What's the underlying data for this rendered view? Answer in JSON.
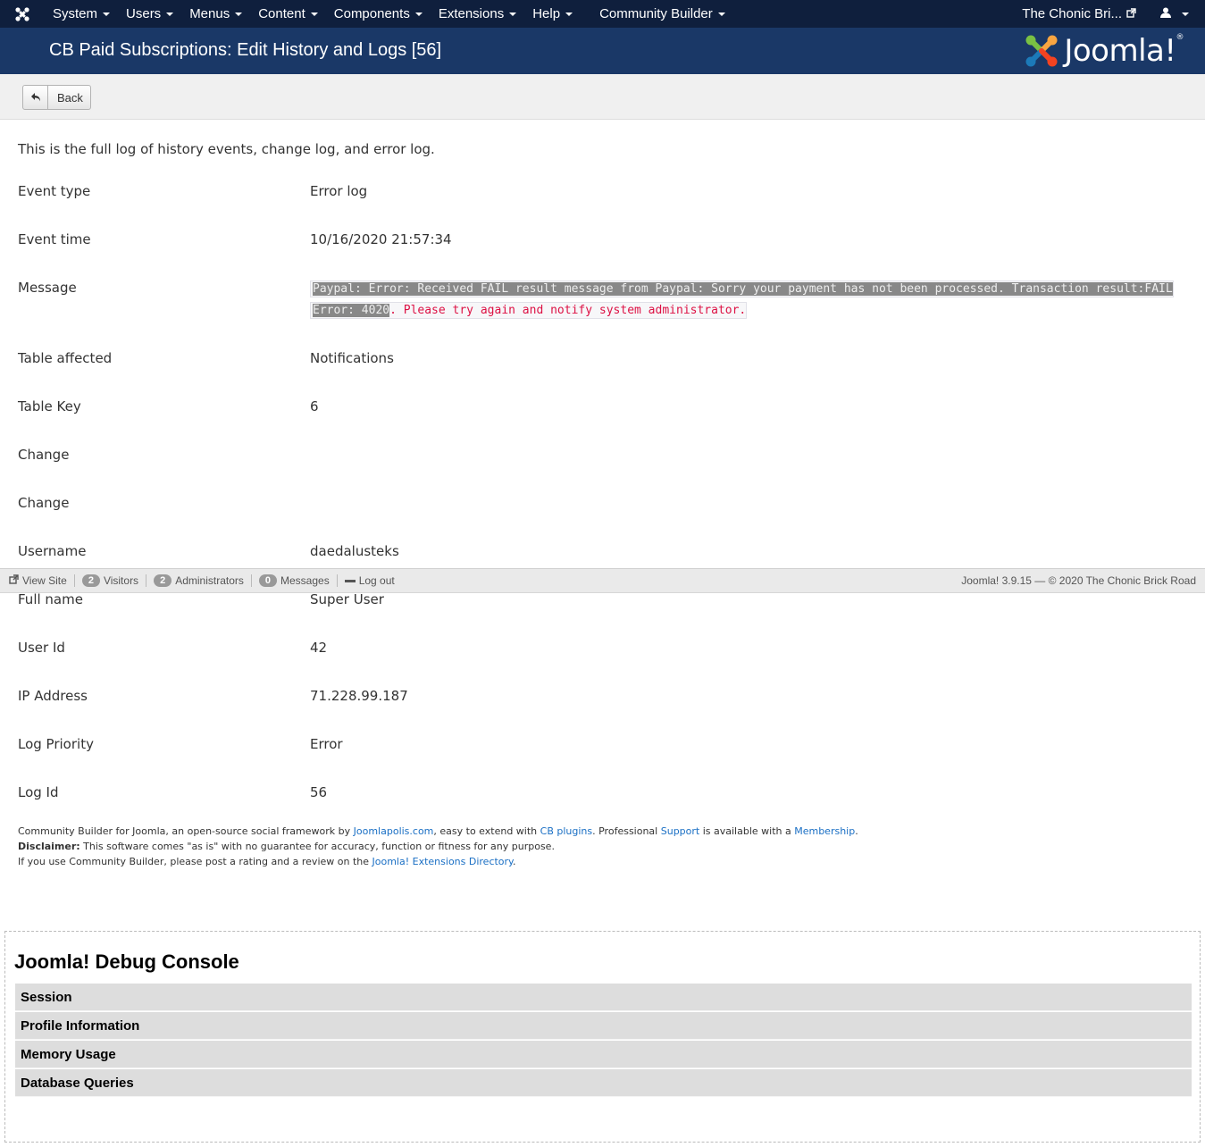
{
  "navbar": {
    "menus": [
      "System",
      "Users",
      "Menus",
      "Content",
      "Components",
      "Extensions",
      "Help",
      "Community Builder"
    ],
    "site_link": "The Chonic Bri...",
    "icons": {
      "logo": "joomla-icon",
      "user": "user-icon",
      "external": "external-link-icon"
    }
  },
  "header": {
    "title": "CB Paid Subscriptions: Edit History and Logs [56]",
    "brand": "Joomla!",
    "brand_mark": "®"
  },
  "toolbar": {
    "back_label": "Back"
  },
  "content": {
    "intro": "This is the full log of history events, change log, and error log.",
    "rows": {
      "event_type": {
        "label": "Event type",
        "value": "Error log"
      },
      "event_time": {
        "label": "Event time",
        "value": "10/16/2020 21:57:34"
      },
      "message": {
        "label": "Message",
        "value_highlighted_1": "Paypal: Error: Received FAIL result message from Paypal: Sorry your payment has not been processed. Transaction result:FAIL",
        "value_highlighted_2": "Error: 4020",
        "value_rest": ". Please try again and notify system administrator."
      },
      "table_affected": {
        "label": "Table affected",
        "value": "Notifications"
      },
      "table_key": {
        "label": "Table Key",
        "value": "6"
      },
      "change_1": {
        "label": "Change",
        "value": ""
      },
      "change_2": {
        "label": "Change",
        "value": ""
      },
      "username": {
        "label": "Username",
        "value": "daedalusteks"
      },
      "full_name": {
        "label": "Full name",
        "value": "Super User"
      },
      "user_id": {
        "label": "User Id",
        "value": "42"
      },
      "ip_address": {
        "label": "IP Address",
        "value": "71.228.99.187"
      },
      "log_priority": {
        "label": "Log Priority",
        "value": "Error"
      },
      "log_id": {
        "label": "Log Id",
        "value": "56"
      }
    }
  },
  "statusbar": {
    "view_site": "View Site",
    "visitors_count": "2",
    "visitors": "Visitors",
    "admins_count": "2",
    "admins": "Administrators",
    "messages_count": "0",
    "messages": "Messages",
    "logout": "Log out",
    "version": "Joomla! 3.9.15 — © 2020 The Chonic Brick Road"
  },
  "footer": {
    "line1_a": "Community Builder for Joomla, an open-source social framework by ",
    "link_joomlapolis": "Joomlapolis.com",
    "line1_b": ", easy to extend with ",
    "link_cb_plugins": "CB plugins",
    "line1_c": ". Professional ",
    "link_support": "Support",
    "line1_d": " is available with a ",
    "link_membership": "Membership",
    "line1_e": ".",
    "disclaimer_label": "Disclaimer:",
    "disclaimer_text": " This software comes \"as is\" with no guarantee for accuracy, function or fitness for any purpose.",
    "line3_a": "If you use Community Builder, please post a rating and a review on the ",
    "link_jed": "Joomla! Extensions Directory",
    "line3_b": "."
  },
  "debug": {
    "title": "Joomla! Debug Console",
    "sections": [
      "Session",
      "Profile Information",
      "Memory Usage",
      "Database Queries"
    ]
  }
}
